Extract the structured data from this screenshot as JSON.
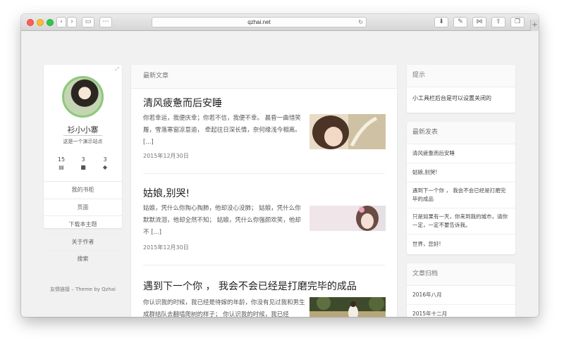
{
  "browser": {
    "url": "qzhai.net",
    "reload_icon": "↻",
    "plus": "+"
  },
  "profile": {
    "name": "衫小小寨",
    "description": "这是一个演示站点",
    "stats": [
      {
        "count": "15",
        "icon": "file-icon"
      },
      {
        "count": "3",
        "icon": "folder-icon"
      },
      {
        "count": "3",
        "icon": "tags-icon"
      }
    ],
    "menu": [
      "我的书柜",
      "页面",
      "下载本主题",
      "关于作者",
      "搜索"
    ]
  },
  "footer_note": "友情链接 – Theme by Qzhai",
  "main": {
    "header": "最新文章",
    "posts": [
      {
        "title": "清风疲惫而后安睡",
        "excerpt": "你若幸运，我便庆幸；你若不信，我便不幸。 晨昏一曲惜笑履，雪落寒窗凉意逾， 牵起往日深长情，奈何缘浅今相离。 [...]",
        "date": "2015年12月30日"
      },
      {
        "title": "姑娘,别哭!",
        "excerpt": "姑娘，凭什么你掏心掏肺，他却没心没肺； 姑娘，凭什么你默默流泪，他却全然不知； 姑娘，凭什么你强颜欢笑，他却不 [...]",
        "date": "2015年12月30日"
      },
      {
        "title": "遇到下一个你 ， 我会不会已经是打磨完毕的成品",
        "excerpt": "你认识我的时候，我已经是待嫁的年龄，你没有见过我和男生成群结队去翻墙爬树的样子； 你认识我的时候，我已经",
        "date": ""
      }
    ]
  },
  "widgets": {
    "tip": {
      "title": "提示",
      "text": "小工具栏后台是可以设置关闭的"
    },
    "recent": {
      "title": "最新发表",
      "items": [
        "清风疲惫而后安睡",
        "姑娘,别哭!",
        "遇到下一个你 ， 我会不会已经是打磨完毕的成品",
        "只是如果有一天，你来到我的城市，请你一定，一定不要告诉我。",
        "世界，您好!"
      ]
    },
    "archive": {
      "title": "文章归档",
      "items": [
        "2016年八月",
        "2015年十二月"
      ]
    }
  }
}
